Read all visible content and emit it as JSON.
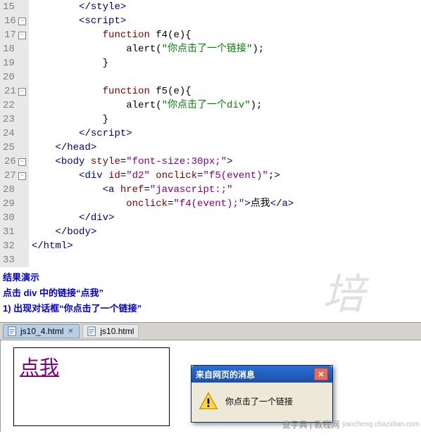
{
  "code": {
    "lines": [
      {
        "n": "15",
        "fold": false,
        "html": "        </<b>style</b>>"
      },
      {
        "n": "16",
        "fold": true,
        "html": "        <<b>script</b>>"
      },
      {
        "n": "17",
        "fold": true,
        "html": "            <r>function</r> f4(e){"
      },
      {
        "n": "18",
        "fold": false,
        "html": "                alert(<g>\"你点击了一个链接\"</g>);"
      },
      {
        "n": "19",
        "fold": false,
        "html": "            }"
      },
      {
        "n": "20",
        "fold": false,
        "html": ""
      },
      {
        "n": "21",
        "fold": true,
        "html": "            <r>function</r> f5(e){"
      },
      {
        "n": "22",
        "fold": false,
        "html": "                alert(<g>\"你点击了一个div\"</g>);"
      },
      {
        "n": "23",
        "fold": false,
        "html": "            }"
      },
      {
        "n": "24",
        "fold": false,
        "html": "        </<b>script</b>>"
      },
      {
        "n": "25",
        "fold": false,
        "html": "    </<b>head</b>>"
      },
      {
        "n": "26",
        "fold": true,
        "html": "    <<b>body</b> <r>style</r>=<p>\"font-size:30px;\"</p>>"
      },
      {
        "n": "27",
        "fold": true,
        "html": "        <<b>div</b> <r>id</r>=<p>\"d2\"</p> <r>onclick</r>=<p>\"f5(event)\"</p><k>;</k>>"
      },
      {
        "n": "28",
        "fold": false,
        "html": "            <<b>a</b> <r>href</r>=<p>\"javascript:;\"</p>"
      },
      {
        "n": "29",
        "fold": false,
        "html": "                <r>onclick</r>=<p>\"f4(event);\"</p>>点我</<b>a</b>>"
      },
      {
        "n": "30",
        "fold": false,
        "html": "        </<b>div</b>>"
      },
      {
        "n": "31",
        "fold": false,
        "html": "    </<b>body</b>>"
      },
      {
        "n": "32",
        "fold": false,
        "html": "</<b>html</b>>"
      },
      {
        "n": "33",
        "fold": false,
        "html": ""
      }
    ]
  },
  "commentary": {
    "line1": "结果演示",
    "line2": "点击 div 中的链接“点我”",
    "line3": "1)    出现对话框“你点击了一个链接”",
    "watermark": "培"
  },
  "tabs": {
    "active": {
      "label": "js10_4.html"
    },
    "inactive": {
      "label": "js10.html"
    }
  },
  "preview": {
    "link_text": "点我"
  },
  "dialog": {
    "title": "来自网页的消息",
    "message": "你点击了一个链接"
  },
  "brand": {
    "text": "查字典 | 教程网",
    "sub": "jiaocheng.chazidian.com"
  }
}
